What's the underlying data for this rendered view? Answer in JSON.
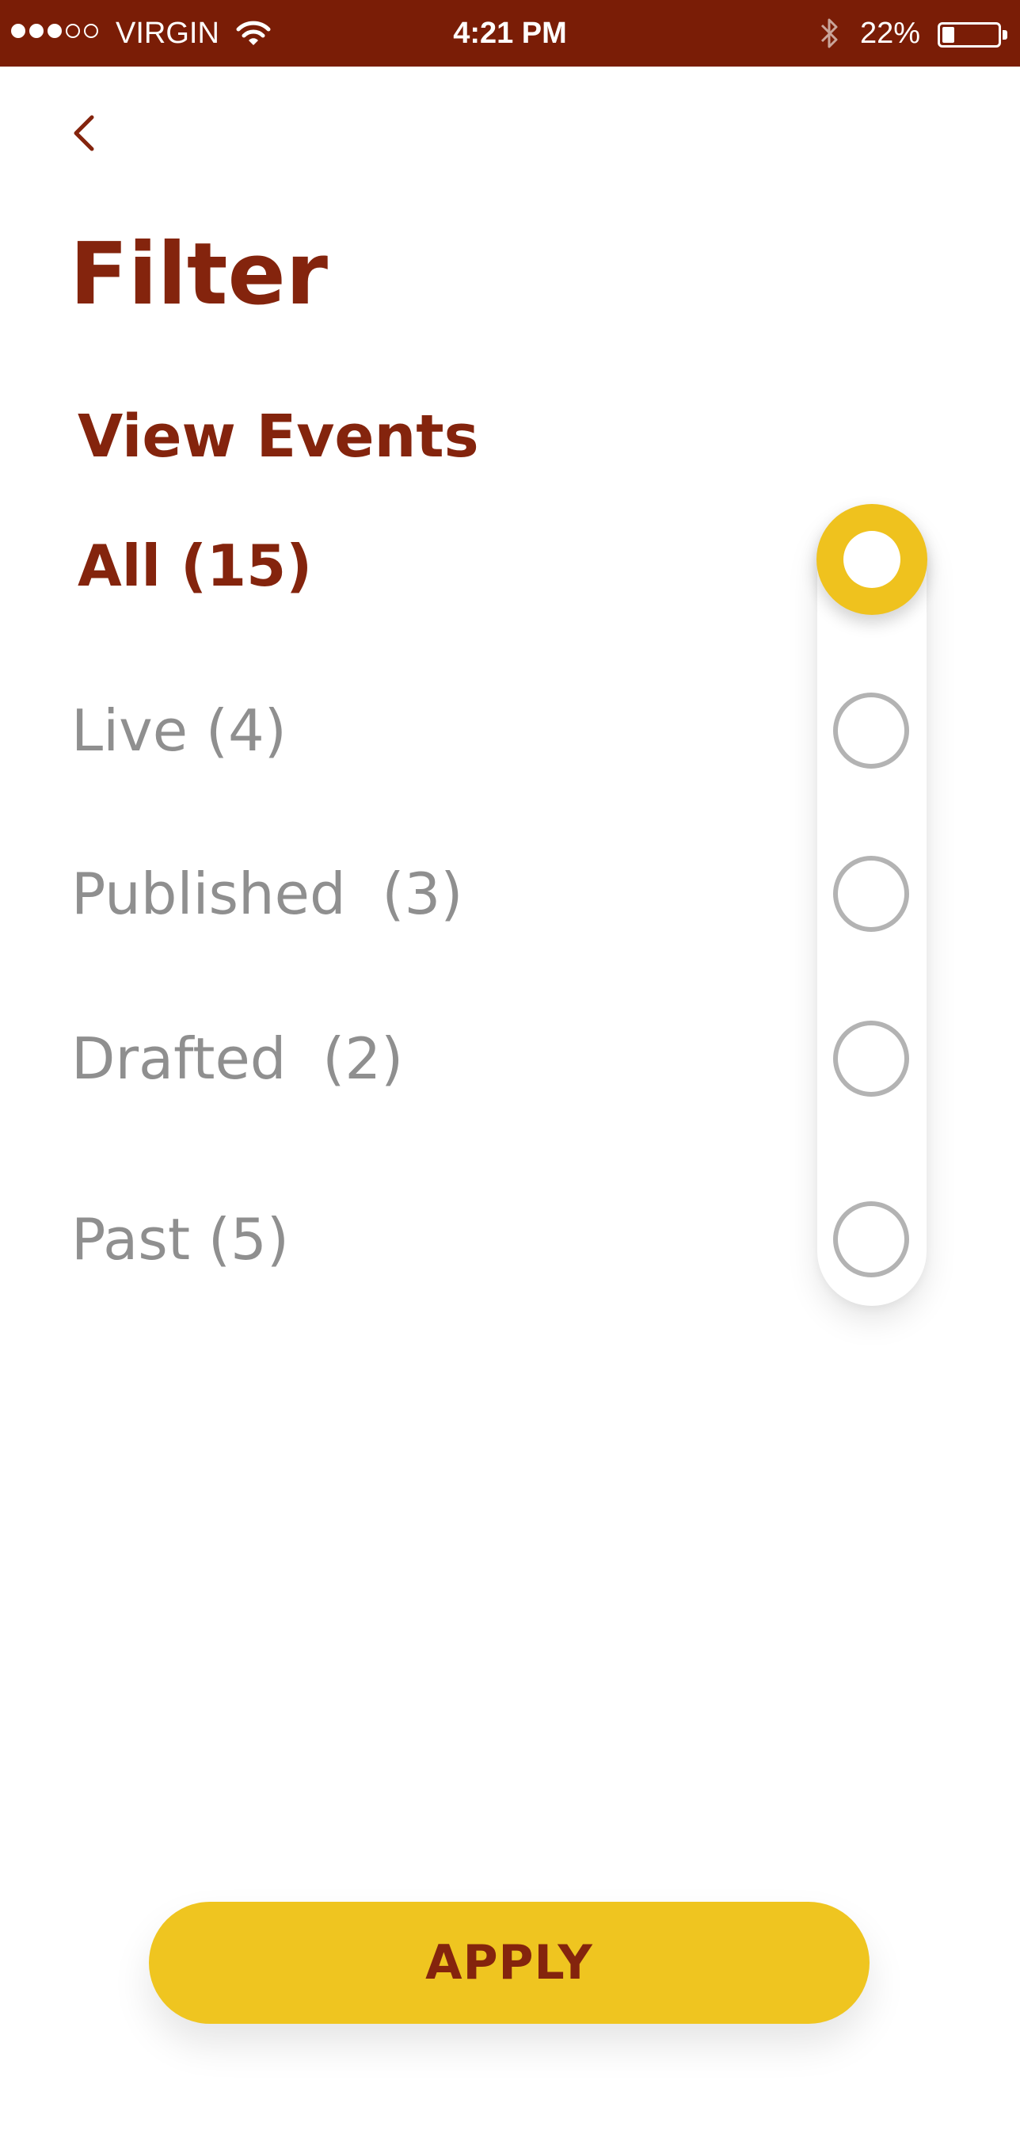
{
  "status_bar": {
    "carrier": "VIRGIN",
    "time": "4:21 PM",
    "battery_percent": "22%",
    "battery_level": 0.22,
    "signal_bars_filled": 3,
    "signal_bars_total": 5,
    "icons": [
      "wifi-icon",
      "bluetooth-icon",
      "battery-icon"
    ]
  },
  "header": {
    "back_icon": "chevron-left-icon",
    "title": "Filter"
  },
  "filter": {
    "section_title": "View Events",
    "options": [
      {
        "label": "All (15)",
        "selected": true
      },
      {
        "label": "Live (4)",
        "selected": false
      },
      {
        "label": "Published  (3)",
        "selected": false
      },
      {
        "label": "Drafted  (2)",
        "selected": false
      },
      {
        "label": "Past (5)",
        "selected": false
      }
    ]
  },
  "actions": {
    "apply_label": "APPLY"
  },
  "colors": {
    "status_bar_bg": "#7a1d06",
    "brand_primary": "#84240d",
    "accent": "#efc21e",
    "inactive_text": "#8f8f8f",
    "radio_border": "#b3b3b3"
  }
}
